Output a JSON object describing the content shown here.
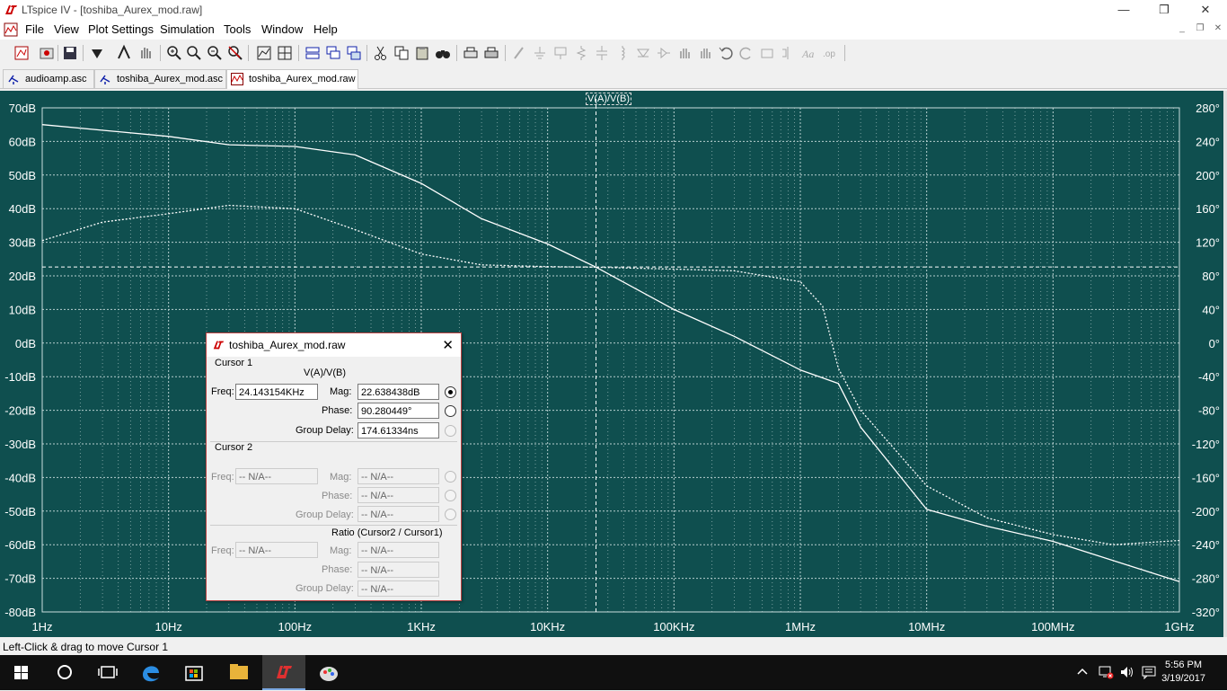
{
  "window": {
    "title": "LTspice IV - [toshiba_Aurex_mod.raw]",
    "controls": {
      "minimize": "—",
      "restore": "❐",
      "close": "✕"
    }
  },
  "menu": {
    "items": [
      "File",
      "View",
      "Plot Settings",
      "Simulation",
      "Tools",
      "Window",
      "Help"
    ],
    "mdi": {
      "minimize": "_",
      "restore": "❐",
      "close": "✕"
    }
  },
  "tabs": [
    {
      "label": "audioamp.asc",
      "icon": "schematic-icon"
    },
    {
      "label": "toshiba_Aurex_mod.asc",
      "icon": "schematic-icon"
    },
    {
      "label": "toshiba_Aurex_mod.raw",
      "icon": "waveform-icon",
      "active": true
    }
  ],
  "plot": {
    "trace_label": "V(A)/V(B)",
    "background": "#0f4f4f",
    "trace_color": "#ffffff"
  },
  "chart_data": {
    "type": "line",
    "title": "V(A)/V(B)",
    "x_scale": "log",
    "x_range": [
      1,
      1000000000
    ],
    "x_ticks": [
      "1Hz",
      "10Hz",
      "100Hz",
      "1KHz",
      "10KHz",
      "100KHz",
      "1MHz",
      "10MHz",
      "100MHz",
      "1GHz"
    ],
    "y_left_range": [
      -80,
      70
    ],
    "y_left_ticks": [
      "70dB",
      "60dB",
      "50dB",
      "40dB",
      "30dB",
      "20dB",
      "10dB",
      "0dB",
      "-10dB",
      "-20dB",
      "-30dB",
      "-40dB",
      "-50dB",
      "-60dB",
      "-70dB",
      "-80dB"
    ],
    "y_right_range": [
      -320,
      280
    ],
    "y_right_ticks": [
      "280°",
      "240°",
      "200°",
      "160°",
      "120°",
      "80°",
      "40°",
      "0°",
      "-40°",
      "-80°",
      "-120°",
      "-160°",
      "-200°",
      "-240°",
      "-280°",
      "-320°"
    ],
    "grid": true,
    "cursor_freq_hz": 24143.154,
    "cursor_mag_db": 22.638438,
    "series": [
      {
        "style": "solid",
        "axis": "left",
        "x": [
          1,
          10,
          30,
          100,
          300,
          1000,
          3000,
          10000,
          24143,
          100000,
          300000,
          1000000,
          2000000,
          3000000,
          10000000,
          30000000,
          100000000,
          1000000000
        ],
        "y": [
          65,
          61.5,
          59,
          58.5,
          56,
          47.5,
          37,
          29.5,
          22.6,
          10,
          2,
          -8,
          -12,
          -25,
          -49.5,
          -54.5,
          -59,
          -71
        ]
      },
      {
        "style": "dotted",
        "axis": "right",
        "x": [
          1,
          3,
          10,
          30,
          100,
          300,
          1000,
          3000,
          10000,
          24143,
          100000,
          300000,
          1000000,
          1500000,
          2000000,
          3000000,
          10000000,
          30000000,
          100000000,
          300000000,
          1000000000
        ],
        "y": [
          122,
          144,
          154,
          164,
          160,
          135,
          106,
          93,
          91,
          90.3,
          88,
          86,
          73,
          44,
          -30,
          -80,
          -170,
          -208,
          -228,
          -240,
          -235
        ]
      }
    ]
  },
  "cursor_dialog": {
    "title": "toshiba_Aurex_mod.raw",
    "cursor1": {
      "group": "Cursor 1",
      "trace": "V(A)/V(B)",
      "freq_label": "Freq:",
      "freq": "24.143154KHz",
      "mag_label": "Mag:",
      "mag": "22.638438dB",
      "phase_label": "Phase:",
      "phase": "90.280449°",
      "gd_label": "Group Delay:",
      "gd": "174.61334ns"
    },
    "cursor2": {
      "group": "Cursor 2",
      "freq_label": "Freq:",
      "freq": "-- N/A--",
      "mag_label": "Mag:",
      "mag": "-- N/A--",
      "phase_label": "Phase:",
      "phase": "-- N/A--",
      "gd_label": "Group Delay:",
      "gd": "-- N/A--"
    },
    "ratio": {
      "group": "Ratio (Cursor2 / Cursor1)",
      "freq_label": "Freq:",
      "freq": "-- N/A--",
      "mag_label": "Mag:",
      "mag": "-- N/A--",
      "phase_label": "Phase:",
      "phase": "-- N/A--",
      "gd_label": "Group Delay:",
      "gd": "-- N/A--"
    }
  },
  "status": "Left-Click & drag to move Cursor 1",
  "taskbar": {
    "time": "5:56 PM",
    "date": "3/19/2017"
  }
}
